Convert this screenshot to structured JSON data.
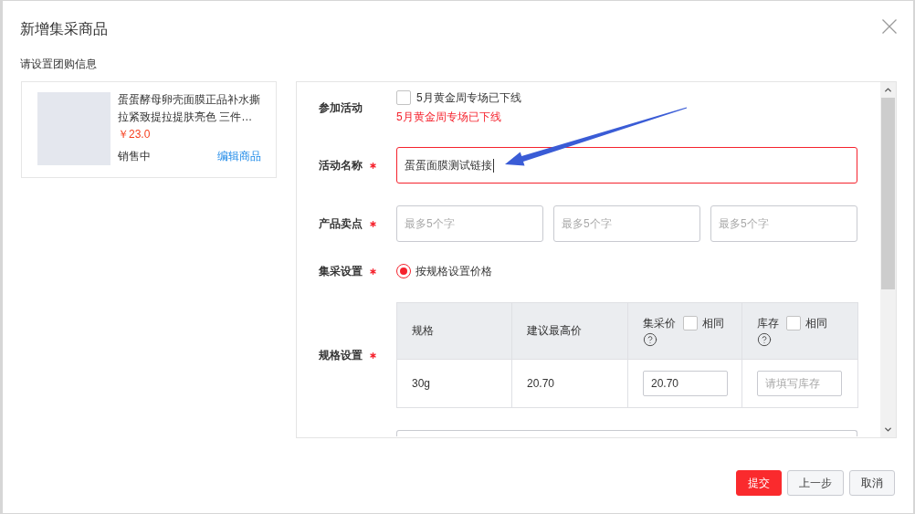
{
  "dialog": {
    "title": "新增集采商品",
    "subtitle": "请设置团购信息"
  },
  "product": {
    "title": "蛋蛋酵母卵壳面膜正品补水撕拉紧致提拉提肤亮色 三件…",
    "price": "￥23.0",
    "status": "销售中",
    "edit_link": "编辑商品"
  },
  "form_rows": [
    {
      "kind": "checkbox",
      "label": "参加活动",
      "required": false,
      "option": {
        "label": "5月黄金周专场已下线",
        "checked": false
      },
      "error": "5月黄金周专场已下线"
    },
    {
      "kind": "text",
      "label": "活动名称",
      "required": true,
      "value": "蛋蛋面膜测试链接",
      "invalid": true,
      "focused": true
    },
    {
      "kind": "inputs",
      "label": "产品卖点",
      "required": true,
      "inputs": [
        {
          "placeholder": "最多5个字"
        },
        {
          "placeholder": "最多5个字"
        },
        {
          "placeholder": "最多5个字"
        }
      ]
    },
    {
      "kind": "radio",
      "label": "集采设置",
      "required": true,
      "options": [
        {
          "label": "按规格设置价格",
          "selected": true
        }
      ]
    },
    {
      "kind": "table",
      "label": "规格设置",
      "required": true,
      "columns": [
        {
          "label": "规格"
        },
        {
          "label": "建议最高价"
        },
        {
          "label": "集采价",
          "same_checkbox": {
            "label": "相同",
            "checked": false
          },
          "help": true
        },
        {
          "label": "库存",
          "same_checkbox": {
            "label": "相同",
            "checked": false
          },
          "help": true
        }
      ],
      "rows": [
        {
          "cells": [
            {
              "kind": "text",
              "text": "30g"
            },
            {
              "kind": "text",
              "text": "20.70"
            },
            {
              "kind": "input",
              "value": "20.70"
            },
            {
              "kind": "input",
              "placeholder": "请填写库存"
            }
          ]
        }
      ]
    },
    {
      "kind": "cut_input"
    }
  ],
  "buttons": [
    {
      "label": "提交",
      "kind": "primary"
    },
    {
      "label": "上一步",
      "kind": "default"
    },
    {
      "label": "取消",
      "kind": "default"
    }
  ]
}
